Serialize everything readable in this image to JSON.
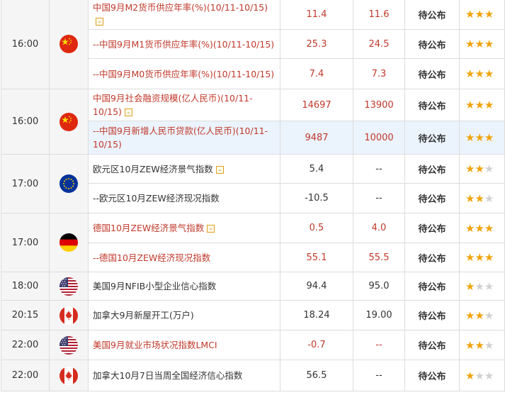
{
  "groups": [
    {
      "time": "16:00",
      "flag": "china-flag-icon",
      "rows": [
        {
          "name": "中国9月M2货币供应年率(%)(10/11-10/15)",
          "prev": "11.4",
          "forecast": "11.6",
          "status": "待公布",
          "stars": 3,
          "expand": "-",
          "color": "red"
        },
        {
          "name": "--中国9月M1货币供应年率(%)(10/11-10/15)",
          "prev": "25.3",
          "forecast": "24.5",
          "status": "待公布",
          "stars": 3,
          "color": "red"
        },
        {
          "name": "--中国9月M0货币供应年率(%)(10/11-10/15)",
          "prev": "7.4",
          "forecast": "7.3",
          "status": "待公布",
          "stars": 3,
          "color": "red"
        }
      ]
    },
    {
      "time": "16:00",
      "flag": "china-flag-icon",
      "rows": [
        {
          "name": "中国9月社会融资规模(亿人民币)(10/11-10/15)",
          "prev": "14697",
          "forecast": "13900",
          "status": "待公布",
          "stars": 3,
          "expand": "-",
          "color": "red"
        },
        {
          "name": "--中国9月新增人民币贷款(亿人民币)(10/11-10/15)",
          "prev": "9487",
          "forecast": "10000",
          "status": "待公布",
          "stars": 3,
          "color": "red",
          "highlight": true
        }
      ]
    },
    {
      "time": "17:00",
      "flag": "eu-flag-icon",
      "rows": [
        {
          "name": "欧元区10月ZEW经济景气指数",
          "prev": "5.4",
          "forecast": "--",
          "status": "待公布",
          "stars": 2,
          "expand": "-",
          "color": "dark"
        },
        {
          "name": "--欧元区10月ZEW经济现况指数",
          "prev": "-10.5",
          "forecast": "--",
          "status": "待公布",
          "stars": 2,
          "color": "dark"
        }
      ]
    },
    {
      "time": "17:00",
      "flag": "germany-flag-icon",
      "rows": [
        {
          "name": "德国10月ZEW经济景气指数",
          "prev": "0.5",
          "forecast": "4.0",
          "status": "待公布",
          "stars": 3,
          "expand": "-",
          "color": "red"
        },
        {
          "name": "--德国10月ZEW经济现况指数",
          "prev": "55.1",
          "forecast": "55.5",
          "status": "待公布",
          "stars": 3,
          "color": "red"
        }
      ]
    },
    {
      "time": "18:00",
      "flag": "usa-flag-icon",
      "rows": [
        {
          "name": "美国9月NFIB小型企业信心指数",
          "prev": "94.4",
          "forecast": "95.0",
          "status": "待公布",
          "stars": 1,
          "color": "dark"
        }
      ]
    },
    {
      "time": "20:15",
      "flag": "canada-flag-icon",
      "rows": [
        {
          "name": "加拿大9月新屋开工(万户)",
          "prev": "18.24",
          "forecast": "19.00",
          "status": "待公布",
          "stars": 2,
          "color": "dark"
        }
      ]
    },
    {
      "time": "22:00",
      "flag": "usa-flag-icon",
      "rows": [
        {
          "name": "美国9月就业市场状况指数LMCI",
          "prev": "-0.7",
          "forecast": "--",
          "status": "待公布",
          "stars": 2,
          "color": "red"
        }
      ]
    },
    {
      "time": "22:00",
      "flag": "canada-flag-icon",
      "rows": [
        {
          "name": "加拿大10月7日当周全国经济信心指数",
          "prev": "56.5",
          "forecast": "--",
          "status": "待公布",
          "stars": 1,
          "color": "dark"
        }
      ]
    }
  ],
  "colors": {
    "accent_red": "#c0392b",
    "star": "#f0a30a",
    "star_off": "#d0d0d0",
    "highlight": "#ebf3fc"
  }
}
